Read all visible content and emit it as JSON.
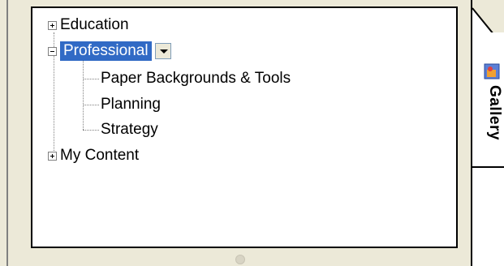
{
  "tree": {
    "items": [
      {
        "label": "Education",
        "expanded": false
      },
      {
        "label": "Professional",
        "expanded": true,
        "selected": true,
        "children": [
          {
            "label": "Paper Backgrounds & Tools"
          },
          {
            "label": "Planning"
          },
          {
            "label": "Strategy"
          }
        ]
      },
      {
        "label": "My Content",
        "expanded": false
      }
    ]
  },
  "side_tab": {
    "label": "Gallery",
    "icon": "gallery-icon"
  },
  "colors": {
    "selection": "#316ac5",
    "background": "#ece9d8"
  }
}
